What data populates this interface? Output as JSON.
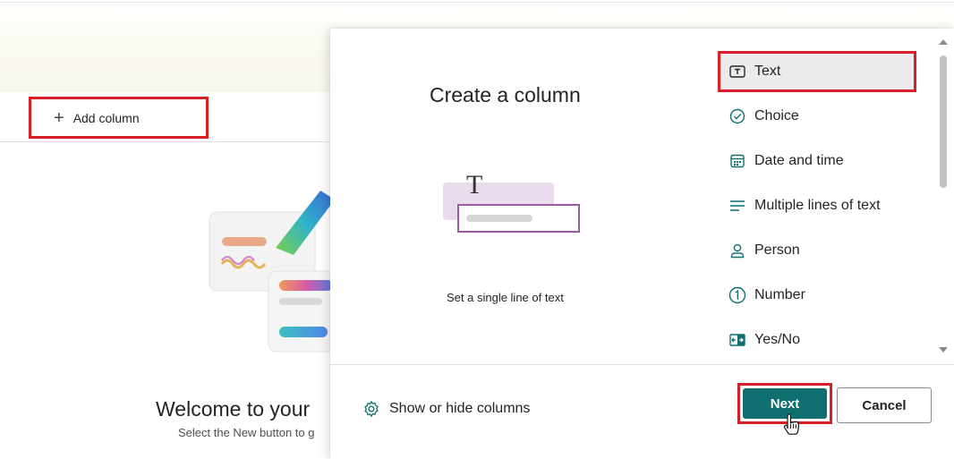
{
  "toolbar": {
    "add_column_label": "Add column"
  },
  "welcome": {
    "title": "Welcome to your",
    "subtitle": "Select the New button to g"
  },
  "panel": {
    "title": "Create a column",
    "preview_caption": "Set a single line of text",
    "column_types": [
      {
        "label": "Text",
        "icon": "text-icon",
        "selected": true
      },
      {
        "label": "Choice",
        "icon": "choice-icon"
      },
      {
        "label": "Date and time",
        "icon": "calendar-icon"
      },
      {
        "label": "Multiple lines of text",
        "icon": "multiline-icon"
      },
      {
        "label": "Person",
        "icon": "person-icon"
      },
      {
        "label": "Number",
        "icon": "number-icon"
      },
      {
        "label": "Yes/No",
        "icon": "yes-no-icon"
      }
    ],
    "show_hide_label": "Show or hide columns",
    "next_label": "Next",
    "cancel_label": "Cancel"
  },
  "colors": {
    "accent_teal": "#0f6e6e",
    "highlight_red": "#d71f25"
  }
}
